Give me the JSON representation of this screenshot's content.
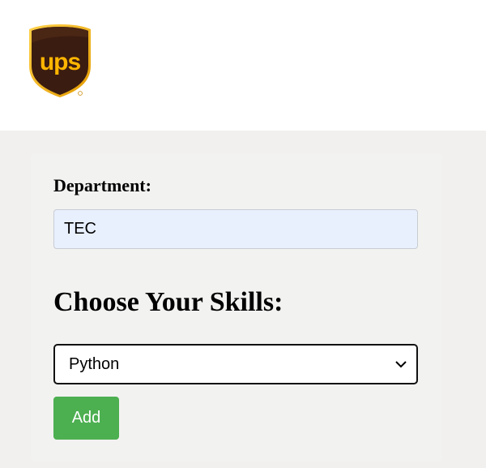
{
  "header": {
    "logo_text": "ups",
    "logo_icon": "ups-shield-logo",
    "colors": {
      "brown": "#351c15",
      "gold": "#ffb500"
    }
  },
  "form": {
    "department_label": "Department:",
    "department_value": "TEC",
    "skills_heading": "Choose Your Skills:",
    "skills_selected": "Python",
    "add_label": "Add"
  },
  "colors": {
    "page_bg": "#f1f0ee",
    "input_bg": "#e8f0fe",
    "button_bg": "#4caf50"
  }
}
